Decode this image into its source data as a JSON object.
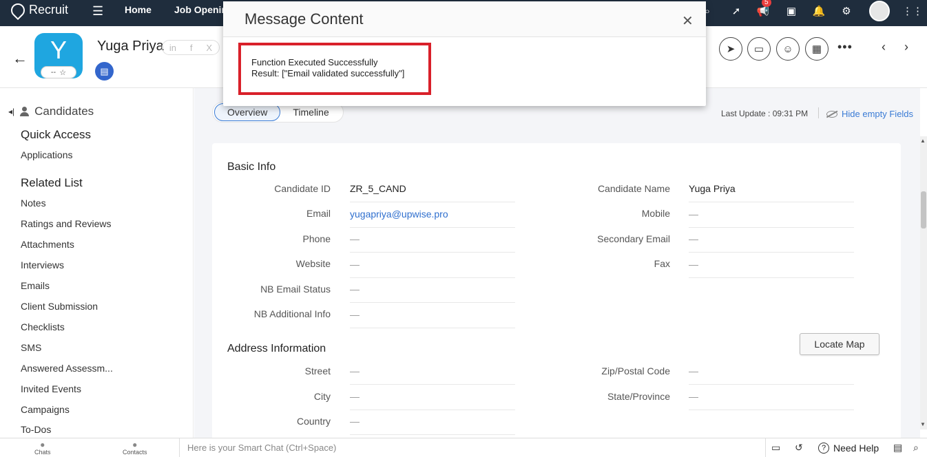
{
  "topnav": {
    "brand": "Recruit",
    "home": "Home",
    "jobs": "Job Openin",
    "notification_count": "5"
  },
  "header": {
    "avatar_letter": "Y",
    "rating_text": "--",
    "name": "Yuga Priya",
    "social": [
      "in",
      "f",
      "X"
    ]
  },
  "sidebar": {
    "module": "Candidates",
    "quick_access_title": "Quick Access",
    "quick_access": [
      "Applications"
    ],
    "related_title": "Related List",
    "related": [
      "Notes",
      "Ratings and Reviews",
      "Attachments",
      "Interviews",
      "Emails",
      "Client Submission",
      "Checklists",
      "SMS",
      "Answered Assessm...",
      "Invited Events",
      "Campaigns",
      "To-Dos"
    ]
  },
  "main": {
    "tabs": [
      {
        "label": "Overview"
      },
      {
        "label": "Timeline"
      }
    ],
    "last_update": "Last Update : 09:31 PM",
    "hide_empty": "Hide empty Fields",
    "basic_info_title": "Basic Info",
    "basic_left": [
      {
        "label": "Candidate ID",
        "value": "ZR_5_CAND"
      },
      {
        "label": "Email",
        "value": "yugapriya@upwise.pro"
      },
      {
        "label": "Phone",
        "value": "—"
      },
      {
        "label": "Website",
        "value": "—"
      },
      {
        "label": "NB Email Status",
        "value": "—"
      },
      {
        "label": "NB Additional Info",
        "value": "—"
      }
    ],
    "basic_right": [
      {
        "label": "Candidate Name",
        "value": "Yuga Priya"
      },
      {
        "label": "Mobile",
        "value": "—"
      },
      {
        "label": "Secondary Email",
        "value": "—"
      },
      {
        "label": "Fax",
        "value": "—"
      }
    ],
    "address_title": "Address Information",
    "locate_map": "Locate Map",
    "address_left": [
      {
        "label": "Street",
        "value": "—"
      },
      {
        "label": "City",
        "value": "—"
      },
      {
        "label": "Country",
        "value": "—"
      }
    ],
    "address_right": [
      {
        "label": "Zip/Postal Code",
        "value": "—"
      },
      {
        "label": "State/Province",
        "value": "—"
      }
    ]
  },
  "bottombar": {
    "chats": "Chats",
    "contacts": "Contacts",
    "smart_chat_placeholder": "Here is your Smart Chat (Ctrl+Space)",
    "need_help": "Need Help"
  },
  "modal": {
    "title": "Message Content",
    "line1": "Function Executed Successfully",
    "line2": "Result: [\"Email validated successfully\"]"
  },
  "colors": {
    "topnav_bg": "#1f2d3d",
    "avatar_bg": "#1fa6e0",
    "link": "#2f6fce",
    "highlight_border": "#d9202a"
  }
}
